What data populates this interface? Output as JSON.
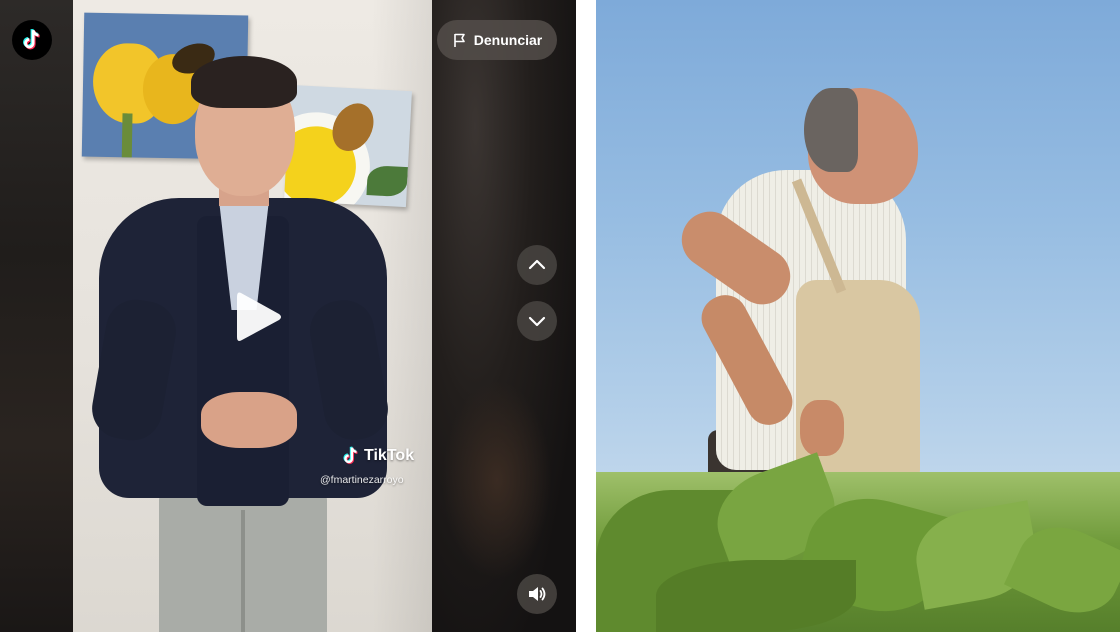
{
  "tiktok_embed": {
    "report_label": "Denunciar",
    "watermark_brand": "TikTok",
    "watermark_handle": "@fmartinezarroyo",
    "icons": {
      "logo": "tiktok-logo-icon",
      "flag": "flag-icon",
      "play": "play-icon",
      "up": "chevron-up-icon",
      "down": "chevron-down-icon",
      "volume": "volume-icon"
    }
  },
  "colors": {
    "panel_bg": "#161414",
    "button_bg": "#46423f",
    "tiktok_cyan": "#25f4ee",
    "tiktok_red": "#fe2c55",
    "sky": "#97bde2",
    "crop_green": "#6f9a3a"
  }
}
